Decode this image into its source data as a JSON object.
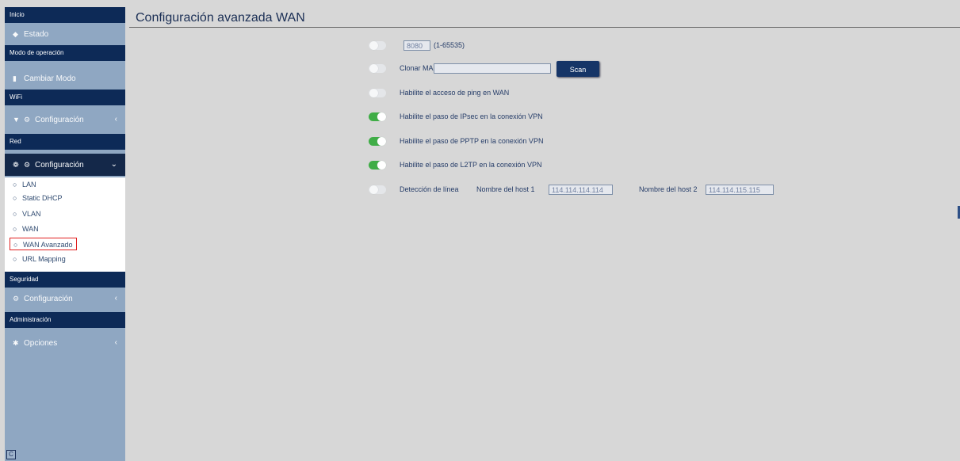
{
  "sidebar": {
    "sections": {
      "inicio": "Inicio",
      "modo": "Modo de operación",
      "wifi": "WiFi",
      "red": "Red",
      "seguridad": "Seguridad",
      "admin": "Administración"
    },
    "items": {
      "estado": "Estado",
      "cambiar_modo": "Cambiar Modo",
      "wifi_config": "Configuración",
      "red_config": "Configuración",
      "seguridad_config": "Configuración",
      "opciones": "Opciones"
    },
    "submenu": [
      "LAN",
      "Static DHCP",
      "VLAN",
      "WAN",
      "WAN Avanzado",
      "URL Mapping"
    ],
    "bottom_icon": "C"
  },
  "main": {
    "title": "Configuración avanzada WAN",
    "port": {
      "value": "8080",
      "range": "(1-65535)",
      "enabled": false
    },
    "clone_mac": {
      "label": "Clonar MAC",
      "value": "",
      "button": "Scan",
      "enabled": false
    },
    "ping_wan": {
      "label": "Habilite el acceso de ping en WAN",
      "enabled": false
    },
    "ipsec": {
      "label": "Habilite el paso de IPsec en la conexión VPN",
      "enabled": true
    },
    "pptp": {
      "label": "Habilite el paso de PPTP en la conexión VPN",
      "enabled": true
    },
    "l2tp": {
      "label": "Habilite el paso de L2TP en la conexión VPN",
      "enabled": true
    },
    "line_detect": {
      "label": "Detección de línea",
      "host1_label": "Nombre del host 1",
      "host1": "114.114.114.114",
      "host2_label": "Nombre del host 2",
      "host2": "114.114.115.115",
      "enabled": false
    }
  },
  "colors": {
    "sidebar": "#8fa7c2",
    "section_header": "#0d2a57",
    "active_item": "#0e2243",
    "toggle_on": "#3fad46",
    "button": "#163567",
    "highlight": "#e02020"
  }
}
